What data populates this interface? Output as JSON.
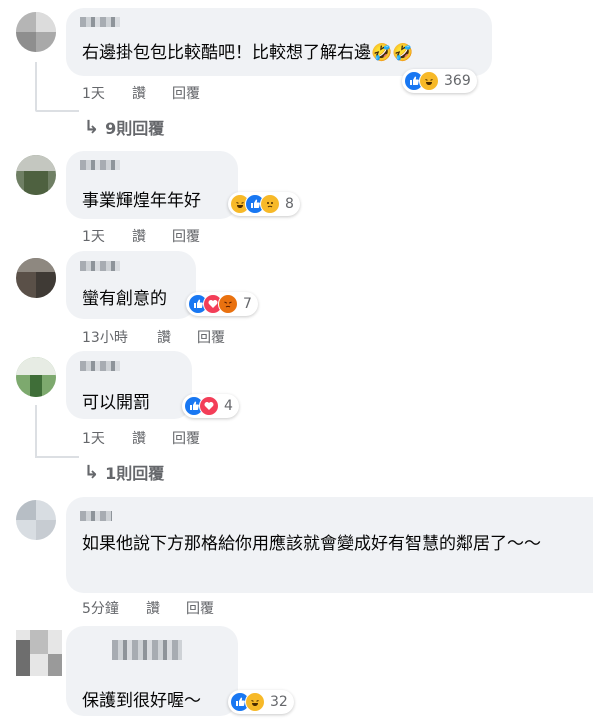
{
  "comments": [
    {
      "text": "右邊掛包包比較酷吧！比較想了解右邊🤣🤣",
      "reaction_count": "369",
      "reactions": [
        "like-icon",
        "haha-icon"
      ],
      "time": "1天",
      "like_label": "讚",
      "reply_label": "回覆",
      "replies_label": "9則回覆"
    },
    {
      "text": "事業輝煌年年好",
      "reaction_count": "8",
      "reactions": [
        "haha-icon",
        "like-icon",
        "sad-icon"
      ],
      "time": "1天",
      "like_label": "讚",
      "reply_label": "回覆"
    },
    {
      "text": "蠻有創意的",
      "reaction_count": "7",
      "reactions": [
        "like-icon",
        "love-icon",
        "angry-icon"
      ],
      "time": "13小時",
      "like_label": "讚",
      "reply_label": "回覆"
    },
    {
      "text": "可以開罰",
      "reaction_count": "4",
      "reactions": [
        "like-icon",
        "love-icon"
      ],
      "time": "1天",
      "like_label": "讚",
      "reply_label": "回覆",
      "replies_label": "1則回覆"
    },
    {
      "text": "如果他說下方那格給你用應該就會變成好有智慧的鄰居了～～",
      "time": "5分鐘",
      "like_label": "讚",
      "reply_label": "回覆"
    },
    {
      "text": "保護到很好喔～",
      "reaction_count": "32",
      "reactions": [
        "like-icon",
        "haha-icon"
      ]
    }
  ],
  "colors": {
    "like": "#1877f2",
    "haha": "#f7b928",
    "love": "#f33e58",
    "angry": "#e9710f",
    "bubble": "#f0f2f5",
    "meta": "#65676b"
  }
}
